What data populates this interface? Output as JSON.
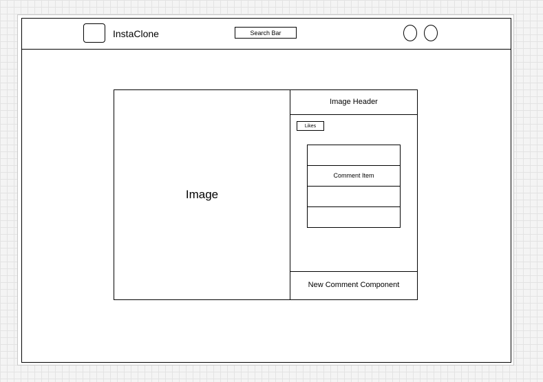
{
  "header": {
    "app_title": "InstaClone",
    "search_label": "Search Bar"
  },
  "post": {
    "image_label": "Image",
    "image_header": "Image Header",
    "likes_label": "Likes",
    "comments": [
      "",
      "Comment Item",
      "",
      ""
    ],
    "new_comment_label": "New Comment Component"
  }
}
